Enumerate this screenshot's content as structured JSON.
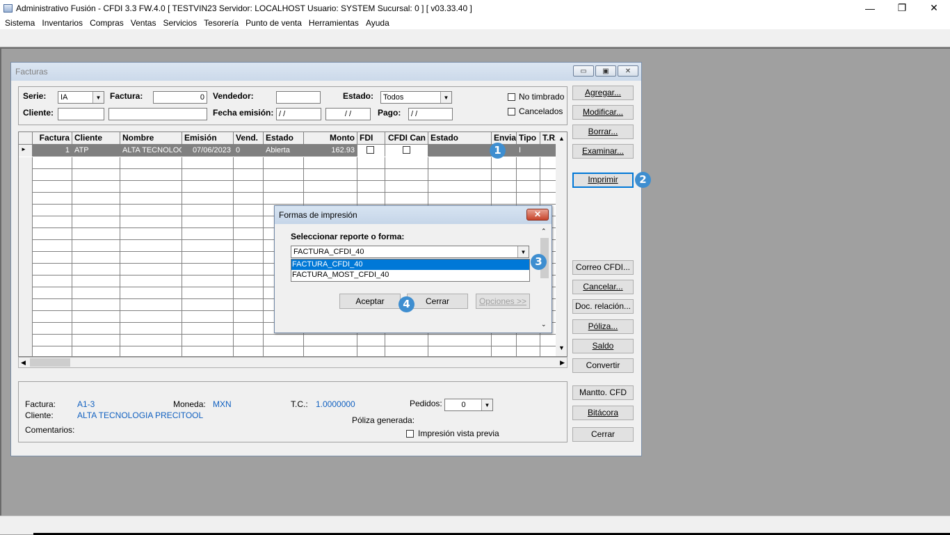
{
  "window": {
    "title": "Administrativo Fusión - CFDI 3.3 FW.4.0 [ TESTVIN23  Servidor: LOCALHOST   Usuario: SYSTEM    Sucursal: 0 ] [ v03.33.40 ]",
    "minimize": "—",
    "maximize": "❐",
    "close": "✕"
  },
  "menu": [
    "Sistema",
    "Inventarios",
    "Compras",
    "Ventas",
    "Servicios",
    "Tesorería",
    "Punto de venta",
    "Herramientas",
    "Ayuda"
  ],
  "facturas": {
    "title": "Facturas",
    "filters": {
      "serie_label": "Serie:",
      "serie_value": "IA",
      "factura_label": "Factura:",
      "factura_value": "0",
      "vendedor_label": "Vendedor:",
      "vendedor_value": "",
      "estado_label": "Estado:",
      "estado_value": "Todos",
      "no_timbrado_label": "No timbrado",
      "cancelados_label": "Cancelados",
      "cliente_label": "Cliente:",
      "cliente_value": "",
      "cliente_name_value": "",
      "fecha_label": "Fecha emisión:",
      "fecha_from": " / /",
      "fecha_to": " / /",
      "pago_label": "Pago:",
      "pago_value": " / /"
    },
    "grid": {
      "columns": [
        "Factura",
        "Cliente",
        "Nombre",
        "Emisión",
        "Vend.",
        "Estado",
        "Monto",
        "FDI",
        "CFDI Can",
        "Estado",
        "Envia",
        "Tipo",
        "T.R."
      ],
      "rows": [
        {
          "factura": "1",
          "cliente": "ATP",
          "nombre": "ALTA TECNOLOG",
          "emision": "07/06/2023",
          "vend": "0",
          "estado": "Abierta",
          "monto": "162.93",
          "tipo": "I"
        }
      ]
    },
    "buttons": {
      "agregar": "Agregar...",
      "modificar": "Modificar...",
      "borrar": "Borrar...",
      "examinar": "Examinar...",
      "imprimir": "Imprimir",
      "correo": "Correo CFDI...",
      "cancelar": "Cancelar...",
      "doc_relacion": "Doc. relación...",
      "poliza": "Póliza...",
      "saldo": "Saldo",
      "convertir": "Convertir",
      "mantto": "Mantto. CFD",
      "bitacora": "Bitácora",
      "cerrar": "Cerrar"
    },
    "info": {
      "factura_label": "Factura:",
      "factura_value": "A1-3",
      "moneda_label": "Moneda:",
      "moneda_value": "MXN",
      "tc_label": "T.C.:",
      "tc_value": "1.0000000",
      "pedidos_label": "Pedidos:",
      "pedidos_value": "0",
      "cliente_label": "Cliente:",
      "cliente_value": "ALTA TECNOLOGIA PRECITOOL",
      "poliza_label": "Póliza generada:",
      "comentarios_label": "Comentarios:",
      "vista_previa_label": "Impresión vista previa"
    }
  },
  "dialog": {
    "title": "Formas de impresión",
    "close": "✕",
    "prompt": "Seleccionar reporte o forma:",
    "selected": "FACTURA_CFDI_40",
    "options": [
      "FACTURA_CFDI_40",
      "FACTURA_MOST_CFDI_40"
    ],
    "aceptar": "Aceptar",
    "cerrar": "Cerrar",
    "opciones": "Opciones >>"
  },
  "badges": [
    "1",
    "2",
    "3",
    "4"
  ],
  "colors": {
    "badge": "#3e8ed0",
    "selection": "#0078d7",
    "info_value": "#1060c0"
  }
}
